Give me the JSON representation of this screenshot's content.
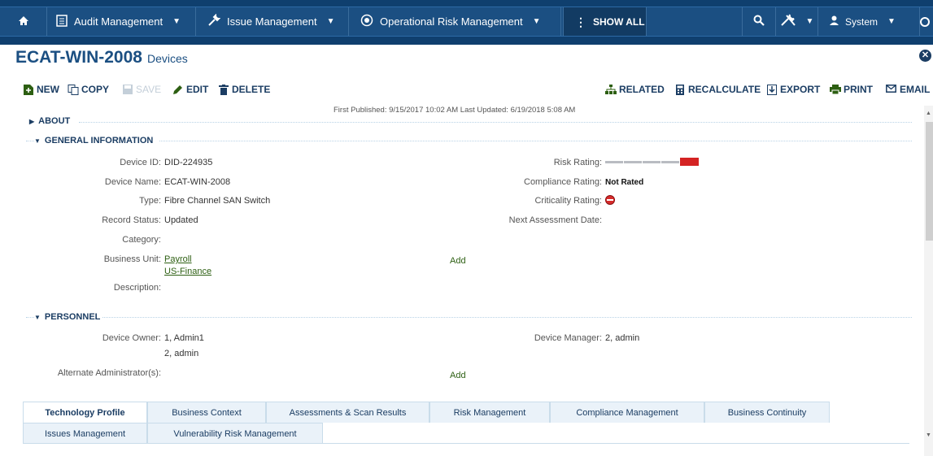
{
  "nav": {
    "home_icon": "home-icon",
    "audit": "Audit Management",
    "issue": "Issue Management",
    "oprisk": "Operational Risk Management",
    "show_all": "SHOW ALL",
    "user": "System"
  },
  "header": {
    "title": "ECAT-WIN-2008",
    "subtitle": "Devices"
  },
  "toolbar": {
    "new": "NEW",
    "copy": "COPY",
    "save": "SAVE",
    "edit": "EDIT",
    "delete": "DELETE",
    "related": "RELATED",
    "recalculate": "RECALCULATE",
    "export": "EXPORT",
    "print": "PRINT",
    "email": "EMAIL"
  },
  "published": "First Published: 9/15/2017 10:02 AM Last Updated: 6/19/2018 5:08 AM",
  "sections": {
    "about": "ABOUT",
    "general": "GENERAL INFORMATION",
    "personnel": "PERSONNEL"
  },
  "general": {
    "device_id_label": "Device ID:",
    "device_id": "DID-224935",
    "device_name_label": "Device Name:",
    "device_name": "ECAT-WIN-2008",
    "type_label": "Type:",
    "type": "Fibre Channel SAN Switch",
    "record_status_label": "Record Status:",
    "record_status": "Updated",
    "category_label": "Category:",
    "business_unit_label": "Business Unit:",
    "business_units": [
      "Payroll",
      "US-Finance"
    ],
    "business_unit_add": "Add",
    "description_label": "Description:",
    "risk_rating_label": "Risk Rating:",
    "compliance_rating_label": "Compliance Rating:",
    "compliance_rating": "Not Rated",
    "criticality_rating_label": "Criticality Rating:",
    "next_assessment_label": "Next Assessment Date:"
  },
  "personnel": {
    "device_owner_label": "Device Owner:",
    "device_owners": [
      "1, Admin1",
      "2, admin"
    ],
    "device_manager_label": "Device Manager:",
    "device_manager": "2, admin",
    "alt_admin_label": "Alternate Administrator(s):",
    "alt_admin_add": "Add"
  },
  "tabs_row1": [
    "Technology Profile",
    "Business Context",
    "Assessments & Scan Results",
    "Risk Management",
    "Compliance Management",
    "Business Continuity"
  ],
  "tabs_row2": [
    "Issues Management",
    "Vulnerability Risk Management"
  ],
  "colors": {
    "nav_bg": "#1b4f82",
    "accent": "#1b3d63",
    "link": "#2d5f12",
    "risk_red": "#d42323"
  }
}
